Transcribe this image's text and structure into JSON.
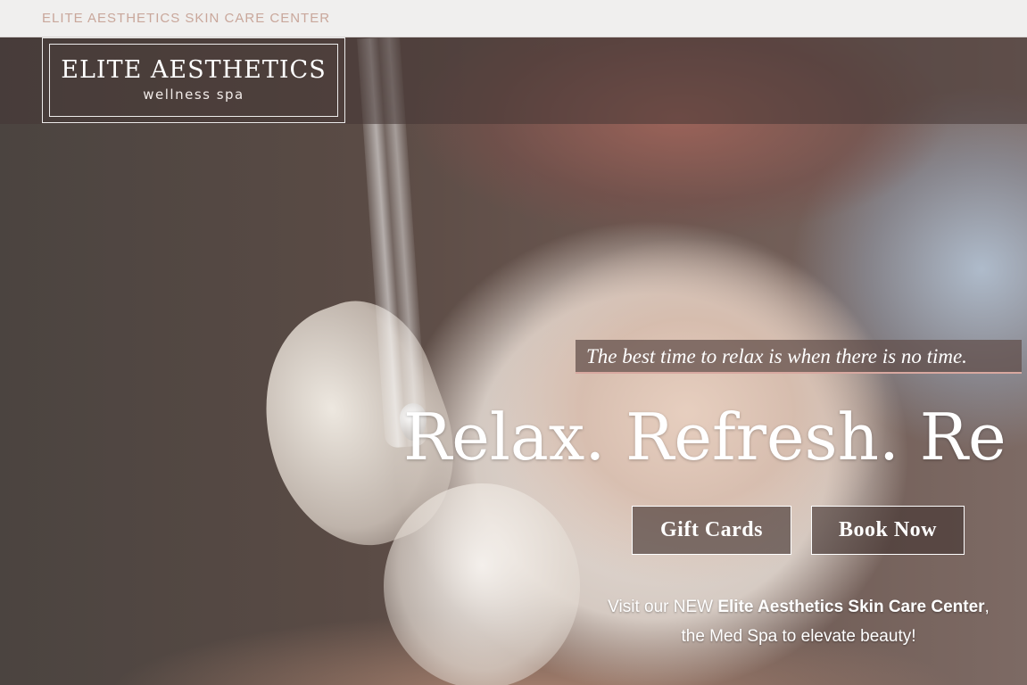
{
  "topbar": {
    "site_link": "ELITE AESTHETICS SKIN CARE CENTER"
  },
  "logo": {
    "title": "ELITE AESTHETICS",
    "subtitle": "wellness spa"
  },
  "hero": {
    "tagline": "The best time to relax is when there is no time.",
    "headline": "Relax. Refresh. Re",
    "buttons": {
      "gift_cards": "Gift Cards",
      "book_now": "Book Now"
    },
    "visit": {
      "prefix": "Visit our NEW ",
      "highlight": "Elite Aesthetics Skin Care Center",
      "suffix": ",",
      "line2": "the Med Spa to elevate beauty!"
    }
  }
}
